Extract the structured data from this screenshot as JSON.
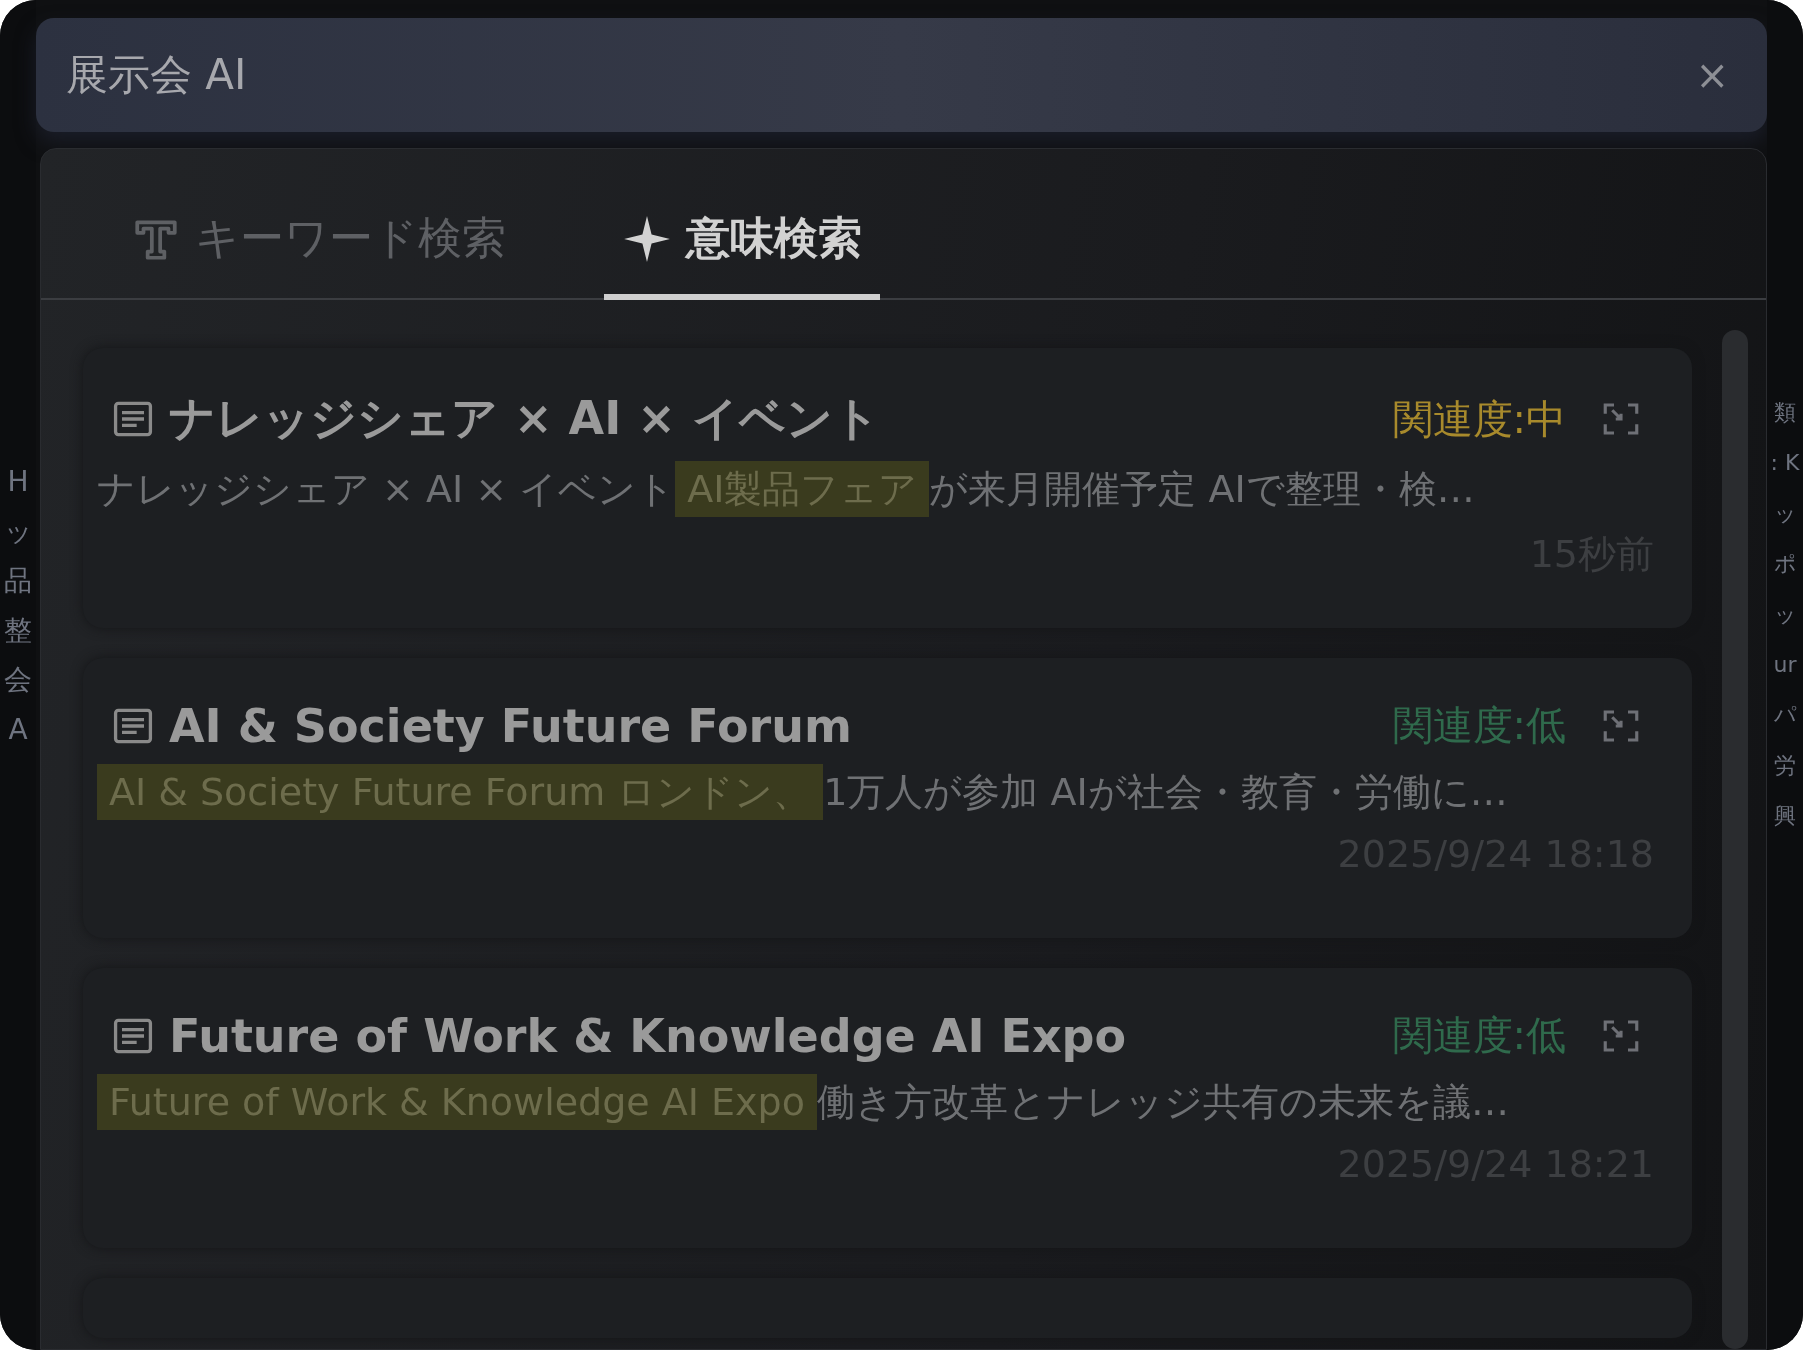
{
  "window": {
    "title": "展示会 AI",
    "close": "×"
  },
  "background_left": [
    "H",
    "ッ",
    "品",
    "整",
    "会",
    "A"
  ],
  "background_right": [
    "類",
    ": K",
    "ッ",
    "ポ",
    "ッ",
    "ur",
    "パ",
    "労",
    "興"
  ],
  "tabs": [
    {
      "label": "キーワード検索",
      "kind": "keyword",
      "selected": false
    },
    {
      "label": "意味検索",
      "kind": "semantic",
      "selected": true
    }
  ],
  "results": [
    {
      "title": "ナレッジシェア × AI × イベント",
      "relevance": "関連度:中",
      "color": "#a88a2c",
      "snippet": [
        {
          "text": "ナレッジシェア × AI × イベント",
          "highlighted": false
        },
        {
          "text": "AI製品フェア",
          "highlighted": true
        },
        {
          "text": "が来月開催予定 AIで整理・検…",
          "highlighted": false
        }
      ],
      "time": "15秒前"
    },
    {
      "title": "AI & Society Future Forum",
      "relevance": "関連度:低",
      "color": "#2f6a4c",
      "snippet": [
        {
          "text": "AI & Society Future Forum ロンドン、",
          "highlighted": true
        },
        {
          "text": "1万人が参加 AIが社会・教育・労働に…",
          "highlighted": false
        }
      ],
      "time": "2025/9/24 18:18"
    },
    {
      "title": "Future of Work & Knowledge AI Expo",
      "relevance": "関連度:低",
      "color": "#2f6a4c",
      "snippet": [
        {
          "text": "Future of Work & Knowledge AI Expo",
          "highlighted": true
        },
        {
          "text": "働き方改革とナレッジ共有の未来を議…",
          "highlighted": false
        }
      ],
      "time": "2025/9/24 18:21"
    }
  ]
}
